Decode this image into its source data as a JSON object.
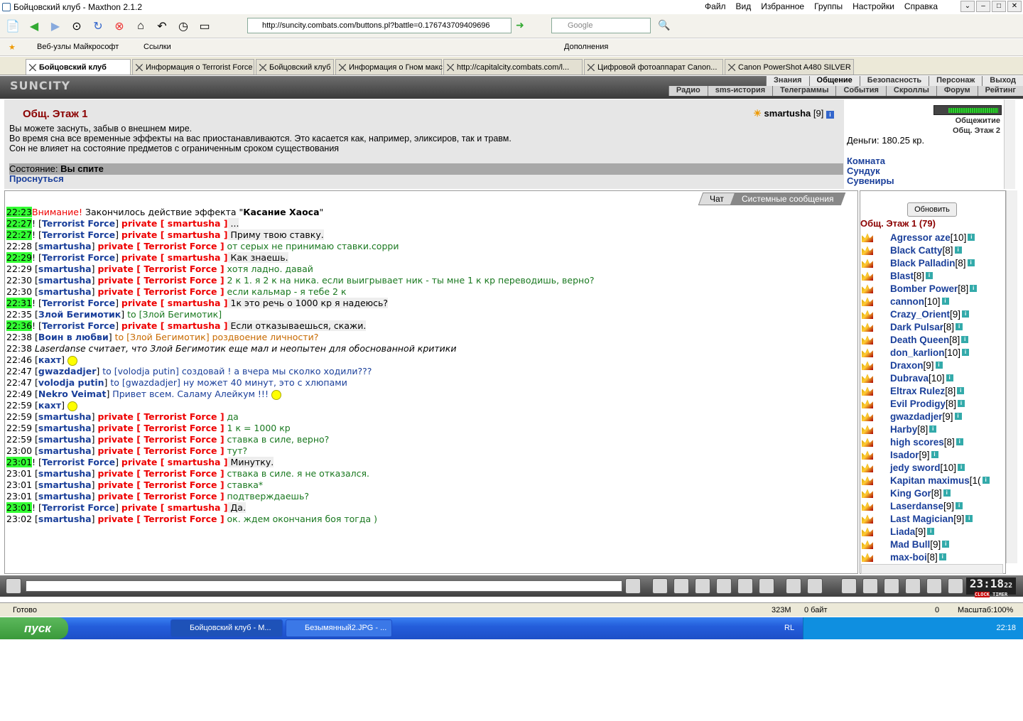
{
  "window": {
    "title": "Бойцовский клуб - Maxthon 2.1.2"
  },
  "menu": [
    "Файл",
    "Вид",
    "Избранное",
    "Группы",
    "Настройки",
    "Справка"
  ],
  "address": {
    "url": "http://suncity.combats.com/buttons.pl?battle=0.176743709409696"
  },
  "search": {
    "placeholder": "Google"
  },
  "favbar": {
    "items": [
      "Веб-узлы Майкрософт",
      "Ссылки"
    ],
    "addons": "Дополнения"
  },
  "tabs": [
    "Бойцовский клуб",
    "Информация о Terrorist Force",
    "Бойцовский клуб",
    "Информация о Гном макс",
    "http://capitalcity.combats.com/l...",
    "Цифровой фотоаппарат Canon...",
    "Canon PowerShot A480 SILVER"
  ],
  "game": {
    "logo": "SUNCITY",
    "nav_top": [
      "Знания",
      "Общение",
      "Безопасность",
      "Персонаж",
      "Выход"
    ],
    "nav_bottom": [
      "Радио",
      "sms-история",
      "Телеграммы",
      "События",
      "Скроллы",
      "Форум",
      "Рейтинг"
    ]
  },
  "room": {
    "title": "Общ. Этаж 1",
    "user": "smartusha",
    "user_level": "[9]",
    "message": [
      "Вы можете заснуть, забыв о внешнем мире.",
      "Во время сна все временные эффекты на вас приостанавливаются. Это касается как, например, эликсиров, так и травм.",
      "Сон не влияет на состояние предметов с ограниченным сроком существования"
    ],
    "state_label": "Состояние:",
    "state_value": "Вы спите",
    "wake": "Проснуться"
  },
  "right": {
    "money": "Деньги: 180.25 кр.",
    "links": [
      "Комната",
      "Сундук",
      "Сувениры"
    ],
    "small": [
      "Общежитие",
      "Общ. Этаж 2"
    ]
  },
  "chat_tabs": [
    "Чат",
    "Системные сообщения"
  ],
  "chat": [
    {
      "t": "22:23",
      "hl": true,
      "parts": [
        [
          "or2",
          "Внимание! "
        ],
        [
          "n",
          "Закончилось действие эффекта \""
        ],
        [
          "b",
          "Касание Хаоса"
        ],
        [
          "n",
          "\""
        ]
      ]
    },
    {
      "t": "22:27",
      "hl": true,
      "parts": [
        [
          "n",
          "! ["
        ],
        [
          "nm",
          "Terrorist Force"
        ],
        [
          "n",
          "] "
        ],
        [
          "pv",
          "private [ smartusha ]"
        ],
        [
          "h",
          " ..."
        ]
      ]
    },
    {
      "t": "22:27",
      "hl": true,
      "parts": [
        [
          "n",
          "! ["
        ],
        [
          "nm",
          "Terrorist Force"
        ],
        [
          "n",
          "] "
        ],
        [
          "pv",
          "private [ smartusha ]"
        ],
        [
          "h",
          " Приму твою ставку."
        ]
      ]
    },
    {
      "t": "22:28",
      "hl": false,
      "parts": [
        [
          "n",
          " ["
        ],
        [
          "nm",
          "smartusha"
        ],
        [
          "n",
          "] "
        ],
        [
          "pv",
          "private [ Terrorist Force ]"
        ],
        [
          "gr",
          " от серых не принимаю ставки.сорри"
        ]
      ]
    },
    {
      "t": "22:29",
      "hl": true,
      "parts": [
        [
          "n",
          "! ["
        ],
        [
          "nm",
          "Terrorist Force"
        ],
        [
          "n",
          "] "
        ],
        [
          "pv",
          "private [ smartusha ]"
        ],
        [
          "h",
          " Как знаешь."
        ]
      ]
    },
    {
      "t": "22:29",
      "hl": false,
      "parts": [
        [
          "n",
          " ["
        ],
        [
          "nm",
          "smartusha"
        ],
        [
          "n",
          "] "
        ],
        [
          "pv",
          "private [ Terrorist Force ]"
        ],
        [
          "gr",
          " хотя ладно. давай"
        ]
      ]
    },
    {
      "t": "22:30",
      "hl": false,
      "parts": [
        [
          "n",
          " ["
        ],
        [
          "nm",
          "smartusha"
        ],
        [
          "n",
          "] "
        ],
        [
          "pv",
          "private [ Terrorist Force ]"
        ],
        [
          "gr",
          " 2 к 1. я 2 к на ника. если выигрывает ник - ты мне 1 к кр переводишь, верно?"
        ]
      ]
    },
    {
      "t": "22:30",
      "hl": false,
      "parts": [
        [
          "n",
          " ["
        ],
        [
          "nm",
          "smartusha"
        ],
        [
          "n",
          "] "
        ],
        [
          "pv",
          "private [ Terrorist Force ]"
        ],
        [
          "gr",
          " если кальмар - я тебе 2 к"
        ]
      ]
    },
    {
      "t": "22:31",
      "hl": true,
      "parts": [
        [
          "n",
          "! ["
        ],
        [
          "nm",
          "Terrorist Force"
        ],
        [
          "n",
          "] "
        ],
        [
          "pv",
          "private [ smartusha ]"
        ],
        [
          "h",
          " 1к это речь о 1000 кр я надеюсь?"
        ]
      ]
    },
    {
      "t": "22:35",
      "hl": false,
      "parts": [
        [
          "n",
          " ["
        ],
        [
          "nm",
          "Злой Бегимотик"
        ],
        [
          "n",
          "] "
        ],
        [
          "gr",
          "to [Злой Бегимотик]"
        ]
      ]
    },
    {
      "t": "22:36",
      "hl": true,
      "parts": [
        [
          "n",
          "! ["
        ],
        [
          "nm",
          "Terrorist Force"
        ],
        [
          "n",
          "] "
        ],
        [
          "pv",
          "private [ smartusha ]"
        ],
        [
          "h",
          " Если отказываешься, скажи."
        ]
      ]
    },
    {
      "t": "22:38",
      "hl": false,
      "parts": [
        [
          "n",
          " ["
        ],
        [
          "nm",
          "Воин в любви"
        ],
        [
          "n",
          "] "
        ],
        [
          "or",
          "to [Злой Бегимотик] роздвоение личности?"
        ]
      ]
    },
    {
      "t": "22:38",
      "hl": false,
      "parts": [
        [
          "i",
          " Laserdanse считает, что Злой Бегимотик еще мал и неопытен для обоснованной критики"
        ]
      ]
    },
    {
      "t": "22:46",
      "hl": false,
      "parts": [
        [
          "n",
          " ["
        ],
        [
          "nm",
          "кахт"
        ],
        [
          "n",
          "] "
        ],
        [
          "s",
          ""
        ]
      ]
    },
    {
      "t": "22:47",
      "hl": false,
      "parts": [
        [
          "n",
          " ["
        ],
        [
          "nm",
          "gwazdadjer"
        ],
        [
          "n",
          "] "
        ],
        [
          "bl",
          "to [volodja putin] создовай ! а вчера мы сколко ходили???"
        ]
      ]
    },
    {
      "t": "22:47",
      "hl": false,
      "parts": [
        [
          "n",
          " ["
        ],
        [
          "nm",
          "volodja putin"
        ],
        [
          "n",
          "] "
        ],
        [
          "bl",
          "to [gwazdadjer] ну может 40 минут, это с хлюпами"
        ]
      ]
    },
    {
      "t": "22:49",
      "hl": false,
      "parts": [
        [
          "n",
          " ["
        ],
        [
          "nm",
          "Nekro Veimat"
        ],
        [
          "n",
          "] "
        ],
        [
          "bl",
          "Привет всем. Саламу Алейкум !!! "
        ],
        [
          "s",
          ""
        ]
      ]
    },
    {
      "t": "22:59",
      "hl": false,
      "parts": [
        [
          "n",
          " ["
        ],
        [
          "nm",
          "кахт"
        ],
        [
          "n",
          "] "
        ],
        [
          "s",
          ""
        ]
      ]
    },
    {
      "t": "22:59",
      "hl": false,
      "parts": [
        [
          "n",
          " ["
        ],
        [
          "nm",
          "smartusha"
        ],
        [
          "n",
          "] "
        ],
        [
          "pv",
          "private [ Terrorist Force ]"
        ],
        [
          "gr",
          " да"
        ]
      ]
    },
    {
      "t": "22:59",
      "hl": false,
      "parts": [
        [
          "n",
          " ["
        ],
        [
          "nm",
          "smartusha"
        ],
        [
          "n",
          "] "
        ],
        [
          "pv",
          "private [ Terrorist Force ]"
        ],
        [
          "gr",
          " 1 к = 1000 кр"
        ]
      ]
    },
    {
      "t": "22:59",
      "hl": false,
      "parts": [
        [
          "n",
          " ["
        ],
        [
          "nm",
          "smartusha"
        ],
        [
          "n",
          "] "
        ],
        [
          "pv",
          "private [ Terrorist Force ]"
        ],
        [
          "gr",
          " ставка в силе, верно?"
        ]
      ]
    },
    {
      "t": "23:00",
      "hl": false,
      "parts": [
        [
          "n",
          " ["
        ],
        [
          "nm",
          "smartusha"
        ],
        [
          "n",
          "] "
        ],
        [
          "pv",
          "private [ Terrorist Force ]"
        ],
        [
          "gr",
          " тут?"
        ]
      ]
    },
    {
      "t": "23:01",
      "hl": true,
      "parts": [
        [
          "n",
          "! ["
        ],
        [
          "nm",
          "Terrorist Force"
        ],
        [
          "n",
          "] "
        ],
        [
          "pv",
          "private [ smartusha ]"
        ],
        [
          "h",
          " Минутку."
        ]
      ]
    },
    {
      "t": "23:01",
      "hl": false,
      "parts": [
        [
          "n",
          " ["
        ],
        [
          "nm",
          "smartusha"
        ],
        [
          "n",
          "] "
        ],
        [
          "pv",
          "private [ Terrorist Force ]"
        ],
        [
          "gr",
          " ствака в силе. я не отказался."
        ]
      ]
    },
    {
      "t": "23:01",
      "hl": false,
      "parts": [
        [
          "n",
          " ["
        ],
        [
          "nm",
          "smartusha"
        ],
        [
          "n",
          "] "
        ],
        [
          "pv",
          "private [ Terrorist Force ]"
        ],
        [
          "gr",
          " ставка*"
        ]
      ]
    },
    {
      "t": "23:01",
      "hl": false,
      "parts": [
        [
          "n",
          " ["
        ],
        [
          "nm",
          "smartusha"
        ],
        [
          "n",
          "] "
        ],
        [
          "pv",
          "private [ Terrorist Force ]"
        ],
        [
          "gr",
          " подтверждаешь?"
        ]
      ]
    },
    {
      "t": "23:01",
      "hl": true,
      "parts": [
        [
          "n",
          "! ["
        ],
        [
          "nm",
          "Terrorist Force"
        ],
        [
          "n",
          "] "
        ],
        [
          "pv",
          "private [ smartusha ]"
        ],
        [
          "h",
          " Да."
        ]
      ]
    },
    {
      "t": "23:02",
      "hl": false,
      "parts": [
        [
          "n",
          " ["
        ],
        [
          "nm",
          "smartusha"
        ],
        [
          "n",
          "] "
        ],
        [
          "pv",
          "private [ Terrorist Force ]"
        ],
        [
          "gr",
          " ок. ждем окончания боя тогда )"
        ]
      ]
    }
  ],
  "users": {
    "refresh": "Обновить",
    "room": "Общ. Этаж 1 (79)",
    "list": [
      [
        "Agressor aze",
        "[10]"
      ],
      [
        "Black Catty",
        "[8]"
      ],
      [
        "Black Palladin",
        "[8]"
      ],
      [
        "Blast",
        "[8]"
      ],
      [
        "Bomber Power",
        "[8]"
      ],
      [
        "cannon",
        "[10]"
      ],
      [
        "Crazy_Orient",
        "[9]"
      ],
      [
        "Dark Pulsar",
        "[8]"
      ],
      [
        "Death Queen",
        "[8]"
      ],
      [
        "don_karlion",
        "[10]"
      ],
      [
        "Draxon",
        "[9]"
      ],
      [
        "Dubrava",
        "[10]"
      ],
      [
        "Eltrax Rulez",
        "[8]"
      ],
      [
        "Evil Prodigy",
        "[8]"
      ],
      [
        "gwazdadjer",
        "[9]"
      ],
      [
        "Harby",
        "[8]"
      ],
      [
        "high scores",
        "[8]"
      ],
      [
        "Isador",
        "[9]"
      ],
      [
        "jedy sword",
        "[10]"
      ],
      [
        "Kapitan maximus",
        "[1("
      ],
      [
        "King Gor",
        "[8]"
      ],
      [
        "Laserdanse",
        "[9]"
      ],
      [
        "Last Magician",
        "[9]"
      ],
      [
        "Liada",
        "[9]"
      ],
      [
        "Mad Bull",
        "[9]"
      ],
      [
        "max-boi",
        "[8]"
      ]
    ]
  },
  "clock": {
    "time": "23:18",
    "sec": "22",
    "l1": "CLOCK",
    "l2": "TIMER"
  },
  "status": {
    "ready": "Готово",
    "mem": "323M",
    "bytes": "0 байт",
    "zero": "0",
    "zoom": "Масштаб:100%"
  },
  "taskbar": {
    "start": "пуск",
    "tasks": [
      "Бойцовский клуб - М...",
      "Безымянный2.JPG - ..."
    ],
    "lang": "RL",
    "time": "22:18"
  },
  "colors": {
    "accent": "#1a3f9a",
    "private": "#e00000",
    "green": "#19781f",
    "highlight": "#33ff33"
  }
}
